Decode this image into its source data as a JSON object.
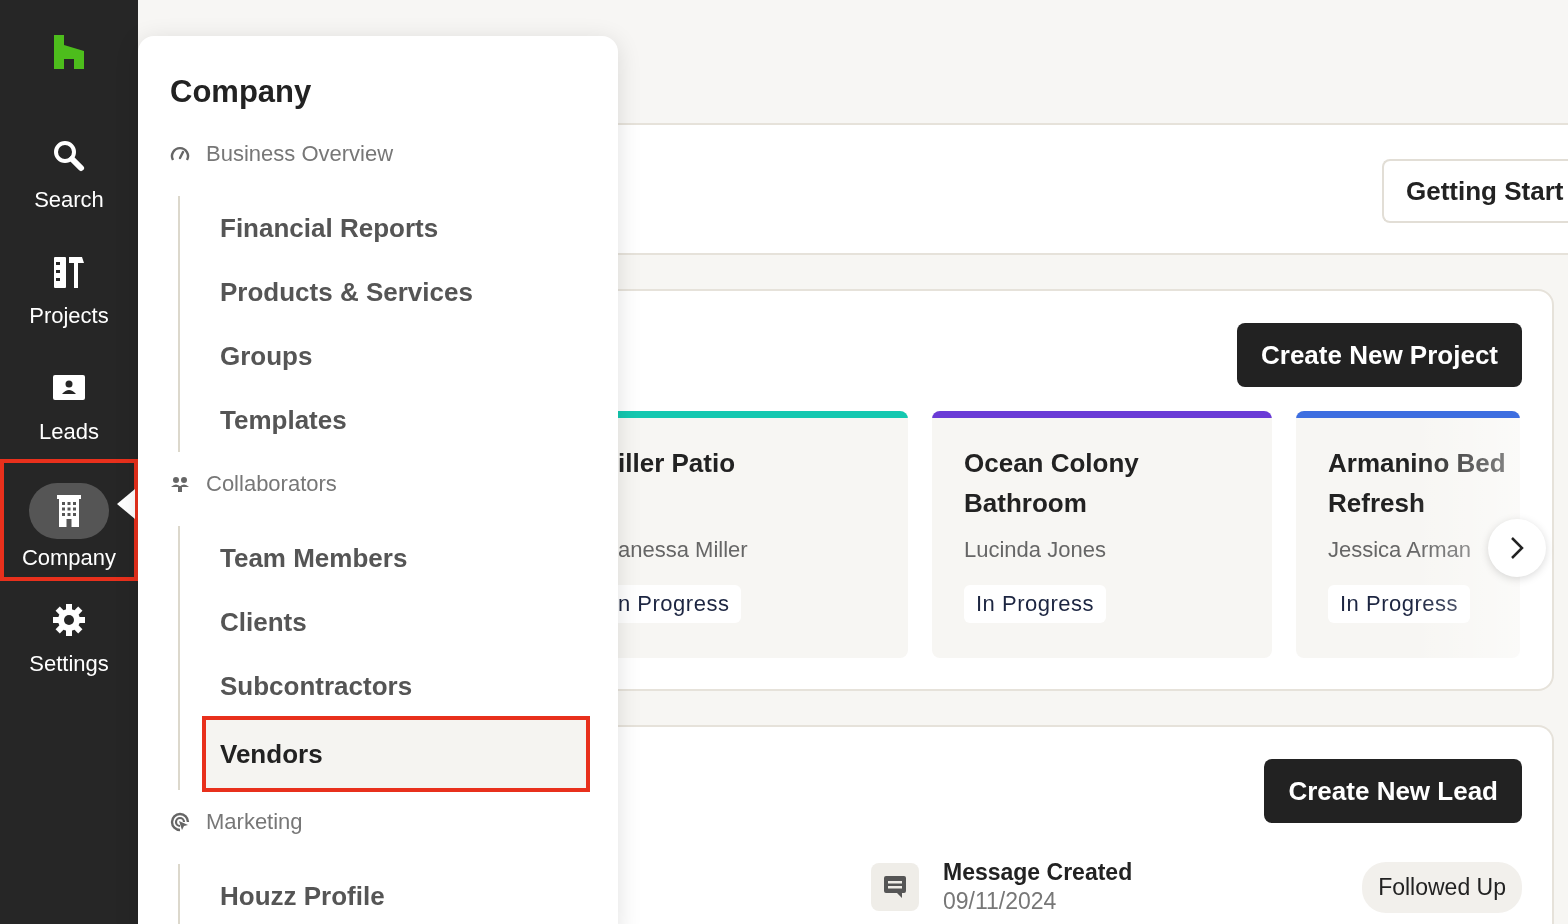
{
  "rail": {
    "items": [
      {
        "label": "Search",
        "kind": "search",
        "selected": false,
        "highlighted": false
      },
      {
        "label": "Projects",
        "kind": "projects",
        "selected": false,
        "highlighted": false
      },
      {
        "label": "Leads",
        "kind": "leads",
        "selected": false,
        "highlighted": false
      },
      {
        "label": "Company",
        "kind": "company",
        "selected": true,
        "highlighted": true
      },
      {
        "label": "Settings",
        "kind": "settings",
        "selected": false,
        "highlighted": false
      }
    ]
  },
  "menu": {
    "title": "Company",
    "sections": [
      {
        "label": "Business Overview",
        "kind": "overview",
        "children": [
          {
            "label": "Financial Reports",
            "selected": false,
            "highlighted": false
          },
          {
            "label": "Products & Services",
            "selected": false,
            "highlighted": false
          },
          {
            "label": "Groups",
            "selected": false,
            "highlighted": false
          },
          {
            "label": "Templates",
            "selected": false,
            "highlighted": false
          }
        ]
      },
      {
        "label": "Collaborators",
        "kind": "collaborators",
        "children": [
          {
            "label": "Team Members",
            "selected": false,
            "highlighted": false
          },
          {
            "label": "Clients",
            "selected": false,
            "highlighted": false
          },
          {
            "label": "Subcontractors",
            "selected": false,
            "highlighted": false
          },
          {
            "label": "Vendors",
            "selected": true,
            "highlighted": true
          }
        ]
      },
      {
        "label": "Marketing",
        "kind": "marketing",
        "children": [
          {
            "label": "Houzz Profile",
            "selected": false,
            "highlighted": false
          }
        ]
      }
    ]
  },
  "header": {
    "button": "Getting Start"
  },
  "projects": {
    "button": "Create New Project",
    "cards": [
      {
        "title": "iller Patio",
        "client": "anessa Miller",
        "status": "n Progress",
        "color": "#14c8b0"
      },
      {
        "title": "Ocean Colony Bathroom",
        "client": "Lucinda Jones",
        "status": "In Progress",
        "color": "#6a3bd6"
      },
      {
        "title": "Armanino Bed Refresh",
        "client": "Jessica Arman",
        "status": "In Progress",
        "color": "#3d6ee0"
      }
    ]
  },
  "leads": {
    "button": "Create New Lead",
    "activity": {
      "title": "Message Created",
      "date": "09/11/2024",
      "status": "Followed Up"
    }
  }
}
